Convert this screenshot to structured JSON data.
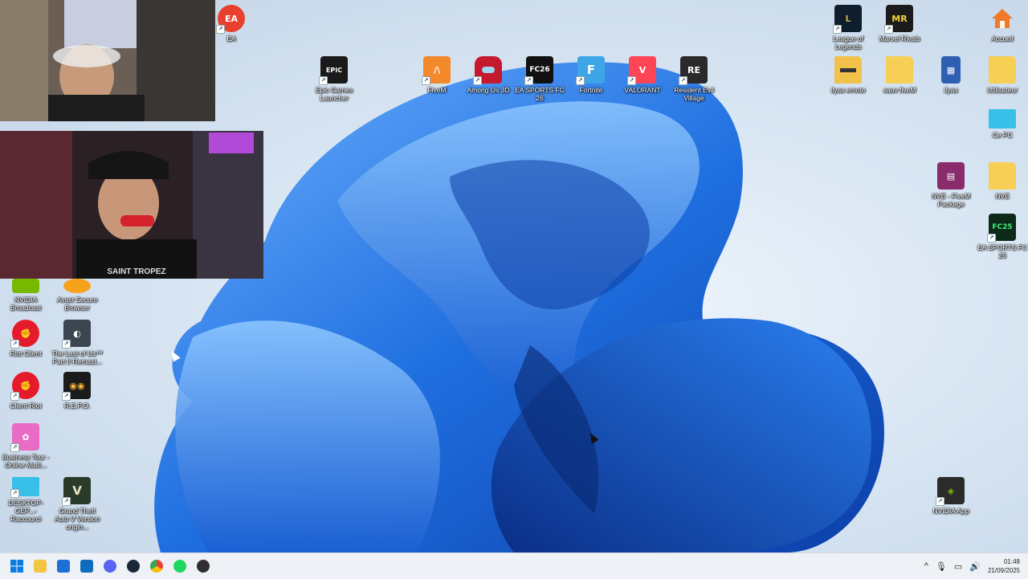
{
  "desktop_icons": {
    "ea": "EA",
    "epic": "Epic Games Launcher",
    "fivem": "FiveM",
    "among_us": "Among Us 3D",
    "fc26": "EA SPORTS FC 26",
    "fortnite": "Fortnite",
    "valorant": "VALORANT",
    "resident_evil": "Resident Evil Village",
    "lol": "League of Legends",
    "marvel_rivals": "Marvel Rivals",
    "accueil": "Accueil",
    "ilyas_emote": "ilyas emote",
    "sauv_fivem": "sauv fiveM",
    "ilyas": "ilyas",
    "utilisateur": "Utilisateur",
    "ce_pc": "Ce PC",
    "nve_package": "NVE - FiveM Package",
    "nve": "NVE",
    "fc25": "EA SPORTS FC 25",
    "nvidia_broadcast": "NVIDIA Broadcast",
    "avast": "Avast Secure Browser",
    "riot_client": "Riot Client",
    "last_of_us": "The Last of Us™ Part II Remast...",
    "client_riot": "Client Riot",
    "repo": "R.E.P.O.",
    "business_tour": "Business Tour - Online Multi...",
    "desktop_shortcut": "DESKTOP-GEP...- Raccourci",
    "gta": "Grand Theft Auto V Version origin...",
    "nvidia_app": "NVIDIA App"
  },
  "webcam_overlay": {
    "streamer2_shirt": "SAINT TROPEZ"
  },
  "taskbar": {
    "apps": [
      "start-icon",
      "file-explorer-icon",
      "store-icon",
      "outlook-icon",
      "discord-icon",
      "steam-icon",
      "chrome-icon",
      "spotify-icon",
      "obs-icon"
    ],
    "tray_chevron": "^",
    "time": "01:48",
    "date": "21/09/2025"
  },
  "colors": {
    "wallpaper_bloom": "#1f6fe0",
    "taskbar_bg": "#eef1f6",
    "accent": "#0a5fd8"
  }
}
